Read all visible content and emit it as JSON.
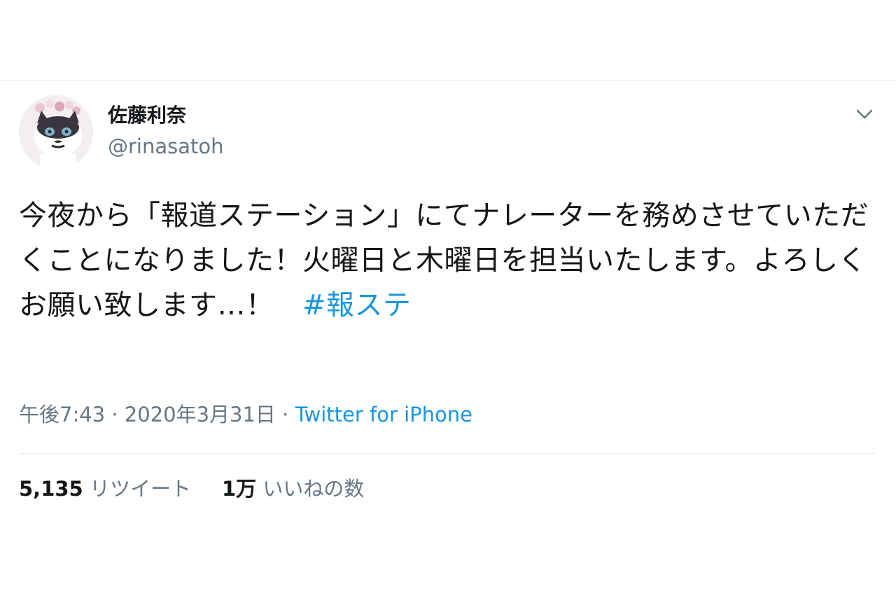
{
  "tweet": {
    "author": {
      "display_name": "佐藤利奈",
      "handle": "@rinasatoh"
    },
    "text": "今夜から「報道ステーション」にてナレーターを務めさせていただくことになりました！火曜日と木曜日を担当いたします。よろしくお願い致します…！　",
    "hashtag": "#報ステ",
    "timestamp": "午後7:43 · 2020年3月31日",
    "separator": " · ",
    "source": "Twitter for iPhone",
    "stats": {
      "retweets_count": "5,135",
      "retweets_label": "リツイート",
      "likes_count": "1万",
      "likes_label": "いいねの数"
    }
  },
  "colors": {
    "text": "#14171a",
    "secondary": "#657786",
    "link": "#1b95e0",
    "divider": "#e6ecf0"
  },
  "icons": {
    "menu": "chevron-down-icon"
  }
}
